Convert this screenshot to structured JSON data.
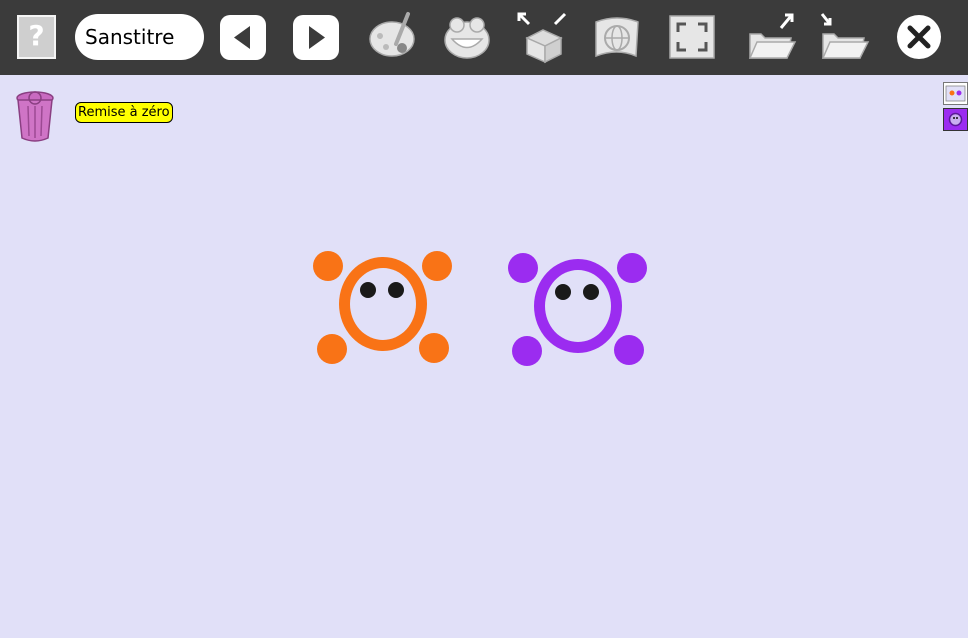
{
  "toolbar": {
    "help_label": "?",
    "title_value": "Sanstitre",
    "background_color": "#3b3b3b",
    "icons": [
      "help-icon",
      "previous-arrow-icon",
      "next-arrow-icon",
      "paint-brush-palette-icon",
      "frog-icon",
      "box-expand-icon",
      "globe-page-icon",
      "fullscreen-icon",
      "folder-export-icon",
      "folder-import-icon",
      "close-icon"
    ]
  },
  "canvas": {
    "background_color": "#e1e0f8",
    "reset_label": "Remise à zéro",
    "reset_color": "#ffff00",
    "trash_icon": "trash-can-icon",
    "sprites": [
      {
        "name": "orange-creature",
        "color": "#f97316"
      },
      {
        "name": "purple-creature",
        "color": "#9b2cf0"
      }
    ]
  },
  "side_panel": {
    "thumbnails": [
      "stage-thumbnail",
      "sprite-thumbnail"
    ]
  }
}
